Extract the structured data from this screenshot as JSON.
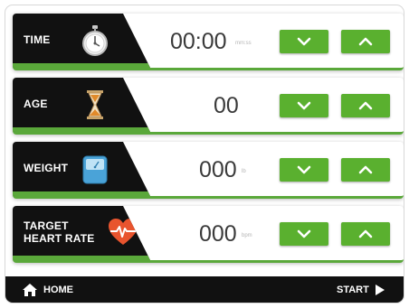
{
  "rows": {
    "time": {
      "label": "TIME",
      "value": "00:00",
      "unit": "mm:ss"
    },
    "age": {
      "label": "AGE",
      "value": "00"
    },
    "weight": {
      "label": "WEIGHT",
      "value": "000",
      "unit": "lb"
    },
    "target_heart_rate": {
      "label_line1": "TARGET",
      "label_line2": "HEART RATE",
      "value": "000",
      "unit": "bpm"
    }
  },
  "footer": {
    "home_label": "HOME",
    "start_label": "START"
  },
  "colors": {
    "accent": "#5ab02f",
    "panel": "#111111",
    "value_text": "#3a3a3a"
  },
  "icons": {
    "time": "stopwatch-icon",
    "age": "hourglass-icon",
    "weight": "scale-icon",
    "target_heart_rate": "heart-rate-icon",
    "down": "chevron-down-icon",
    "up": "chevron-up-icon",
    "home": "home-icon",
    "start": "play-icon"
  }
}
